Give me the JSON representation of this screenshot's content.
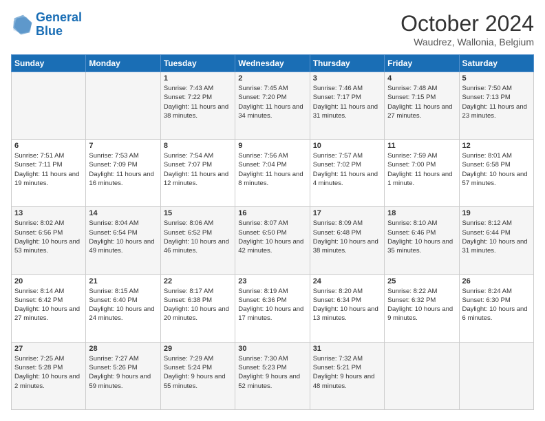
{
  "header": {
    "logo_line1": "General",
    "logo_line2": "Blue",
    "month_title": "October 2024",
    "subtitle": "Waudrez, Wallonia, Belgium"
  },
  "weekdays": [
    "Sunday",
    "Monday",
    "Tuesday",
    "Wednesday",
    "Thursday",
    "Friday",
    "Saturday"
  ],
  "weeks": [
    [
      {
        "day": "",
        "info": ""
      },
      {
        "day": "",
        "info": ""
      },
      {
        "day": "1",
        "info": "Sunrise: 7:43 AM\nSunset: 7:22 PM\nDaylight: 11 hours and 38 minutes."
      },
      {
        "day": "2",
        "info": "Sunrise: 7:45 AM\nSunset: 7:20 PM\nDaylight: 11 hours and 34 minutes."
      },
      {
        "day": "3",
        "info": "Sunrise: 7:46 AM\nSunset: 7:17 PM\nDaylight: 11 hours and 31 minutes."
      },
      {
        "day": "4",
        "info": "Sunrise: 7:48 AM\nSunset: 7:15 PM\nDaylight: 11 hours and 27 minutes."
      },
      {
        "day": "5",
        "info": "Sunrise: 7:50 AM\nSunset: 7:13 PM\nDaylight: 11 hours and 23 minutes."
      }
    ],
    [
      {
        "day": "6",
        "info": "Sunrise: 7:51 AM\nSunset: 7:11 PM\nDaylight: 11 hours and 19 minutes."
      },
      {
        "day": "7",
        "info": "Sunrise: 7:53 AM\nSunset: 7:09 PM\nDaylight: 11 hours and 16 minutes."
      },
      {
        "day": "8",
        "info": "Sunrise: 7:54 AM\nSunset: 7:07 PM\nDaylight: 11 hours and 12 minutes."
      },
      {
        "day": "9",
        "info": "Sunrise: 7:56 AM\nSunset: 7:04 PM\nDaylight: 11 hours and 8 minutes."
      },
      {
        "day": "10",
        "info": "Sunrise: 7:57 AM\nSunset: 7:02 PM\nDaylight: 11 hours and 4 minutes."
      },
      {
        "day": "11",
        "info": "Sunrise: 7:59 AM\nSunset: 7:00 PM\nDaylight: 11 hours and 1 minute."
      },
      {
        "day": "12",
        "info": "Sunrise: 8:01 AM\nSunset: 6:58 PM\nDaylight: 10 hours and 57 minutes."
      }
    ],
    [
      {
        "day": "13",
        "info": "Sunrise: 8:02 AM\nSunset: 6:56 PM\nDaylight: 10 hours and 53 minutes."
      },
      {
        "day": "14",
        "info": "Sunrise: 8:04 AM\nSunset: 6:54 PM\nDaylight: 10 hours and 49 minutes."
      },
      {
        "day": "15",
        "info": "Sunrise: 8:06 AM\nSunset: 6:52 PM\nDaylight: 10 hours and 46 minutes."
      },
      {
        "day": "16",
        "info": "Sunrise: 8:07 AM\nSunset: 6:50 PM\nDaylight: 10 hours and 42 minutes."
      },
      {
        "day": "17",
        "info": "Sunrise: 8:09 AM\nSunset: 6:48 PM\nDaylight: 10 hours and 38 minutes."
      },
      {
        "day": "18",
        "info": "Sunrise: 8:10 AM\nSunset: 6:46 PM\nDaylight: 10 hours and 35 minutes."
      },
      {
        "day": "19",
        "info": "Sunrise: 8:12 AM\nSunset: 6:44 PM\nDaylight: 10 hours and 31 minutes."
      }
    ],
    [
      {
        "day": "20",
        "info": "Sunrise: 8:14 AM\nSunset: 6:42 PM\nDaylight: 10 hours and 27 minutes."
      },
      {
        "day": "21",
        "info": "Sunrise: 8:15 AM\nSunset: 6:40 PM\nDaylight: 10 hours and 24 minutes."
      },
      {
        "day": "22",
        "info": "Sunrise: 8:17 AM\nSunset: 6:38 PM\nDaylight: 10 hours and 20 minutes."
      },
      {
        "day": "23",
        "info": "Sunrise: 8:19 AM\nSunset: 6:36 PM\nDaylight: 10 hours and 17 minutes."
      },
      {
        "day": "24",
        "info": "Sunrise: 8:20 AM\nSunset: 6:34 PM\nDaylight: 10 hours and 13 minutes."
      },
      {
        "day": "25",
        "info": "Sunrise: 8:22 AM\nSunset: 6:32 PM\nDaylight: 10 hours and 9 minutes."
      },
      {
        "day": "26",
        "info": "Sunrise: 8:24 AM\nSunset: 6:30 PM\nDaylight: 10 hours and 6 minutes."
      }
    ],
    [
      {
        "day": "27",
        "info": "Sunrise: 7:25 AM\nSunset: 5:28 PM\nDaylight: 10 hours and 2 minutes."
      },
      {
        "day": "28",
        "info": "Sunrise: 7:27 AM\nSunset: 5:26 PM\nDaylight: 9 hours and 59 minutes."
      },
      {
        "day": "29",
        "info": "Sunrise: 7:29 AM\nSunset: 5:24 PM\nDaylight: 9 hours and 55 minutes."
      },
      {
        "day": "30",
        "info": "Sunrise: 7:30 AM\nSunset: 5:23 PM\nDaylight: 9 hours and 52 minutes."
      },
      {
        "day": "31",
        "info": "Sunrise: 7:32 AM\nSunset: 5:21 PM\nDaylight: 9 hours and 48 minutes."
      },
      {
        "day": "",
        "info": ""
      },
      {
        "day": "",
        "info": ""
      }
    ]
  ]
}
